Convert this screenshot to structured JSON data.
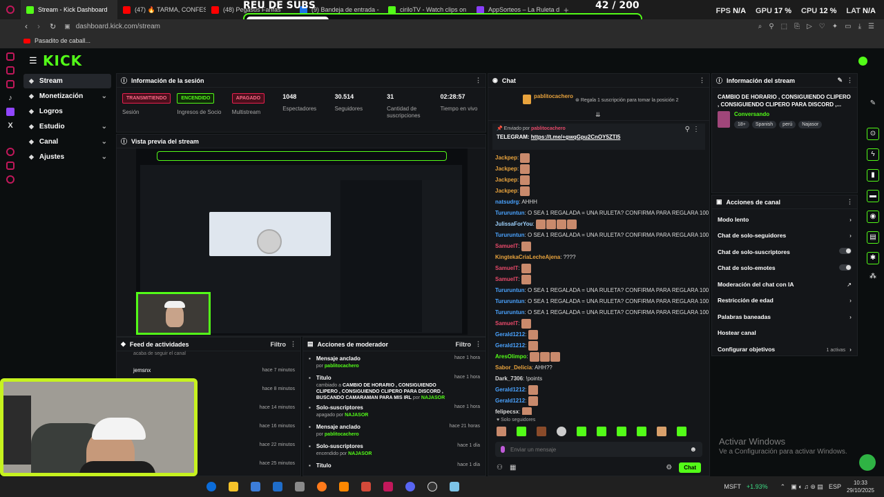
{
  "browser": {
    "tabs": [
      {
        "label": "Stream - Kick Dashboard",
        "color": "#53fc18",
        "active": true
      },
      {
        "label": "(47) 🔥 TARMA, CONFESI",
        "color": "#ff0000",
        "active": false
      },
      {
        "label": "(48) Pegasus Fanfas",
        "color": "#ff0000",
        "active": false
      },
      {
        "label": "(9) Bandeja de entrada -",
        "color": "#1a73e8",
        "active": false
      },
      {
        "label": "cirilоTV - Watch clips on",
        "color": "#53fc18",
        "active": false
      },
      {
        "label": "AppSorteos – La Ruleta de",
        "color": "#8a3ffc",
        "active": false
      }
    ],
    "url": "dashboard.kick.com/stream",
    "bookmark": "Pasadito de caball..."
  },
  "overlay": {
    "title": "REU DE SUBS",
    "count": "42 / 200",
    "progress": 0.21
  },
  "perf": {
    "fps_label": "FPS",
    "fps": "N/A",
    "gpu_label": "GPU",
    "gpu": "17 %",
    "cpu_label": "CPU",
    "cpu": "12 %",
    "lat_label": "LAT",
    "lat": "N/A"
  },
  "kick": {
    "logo": "KICK"
  },
  "nav": [
    {
      "label": "Stream",
      "active": true,
      "icon": "signal-icon"
    },
    {
      "label": "Monetización",
      "chevron": true,
      "icon": "dollar-icon"
    },
    {
      "label": "Logros",
      "icon": "trophy-icon"
    },
    {
      "label": "Estudio",
      "chevron": true,
      "icon": "studio-icon"
    },
    {
      "label": "Canal",
      "chevron": true,
      "icon": "flag-icon"
    },
    {
      "label": "Ajustes",
      "chevron": true,
      "icon": "gear-icon"
    }
  ],
  "session": {
    "title": "Información de la sesión",
    "items": [
      {
        "badge": "TRANSMITIENDO",
        "badge_color": "#e91e4e",
        "label": "Sesión"
      },
      {
        "badge": "ENCENDIDO",
        "badge_color": "#53fc18",
        "label": "Ingresos de Socio"
      },
      {
        "badge": "APAGADO",
        "badge_color": "#e91e4e",
        "label": "Multistream"
      },
      {
        "value": "1048",
        "label": "Espectadores"
      },
      {
        "value": "30.514",
        "label": "Seguidores"
      },
      {
        "value": "31",
        "label": "Cantidad de suscripciones"
      },
      {
        "value": "02:28:57",
        "label": "Tiempo en vivo"
      }
    ]
  },
  "preview": {
    "title": "Vista previa del stream"
  },
  "feed": {
    "title": "Feed de actividades",
    "filter": "Filtro",
    "rows": [
      {
        "user": "acaba de seguir el canal",
        "time": ""
      },
      {
        "user": "jemsnx",
        "time": "hace 7 minutos"
      },
      {
        "user": "",
        "time": "hace 8 minutos"
      },
      {
        "user": "",
        "time": "hace 14 minutos"
      },
      {
        "user": "",
        "time": "hace 16 minutos"
      },
      {
        "user": "",
        "time": "hace 22 minutos"
      },
      {
        "user": "",
        "time": "hace 25 minutos"
      }
    ]
  },
  "mod": {
    "title": "Acciones de moderador",
    "filter": "Filtro",
    "rows": [
      {
        "title": "Mensaje anclado",
        "sub_pre": "por ",
        "sub_user": "pablitocachero",
        "time": "hace 1 hora"
      },
      {
        "title": "Título",
        "sub_pre": "cambiado a ",
        "sub_bold": "CAMBIO DE HORARIO , CONSIGUIENDO CLIPERO , CONSIGUIENDO CLIPERO PARA DISCORD , BUSCANDO CAMARAMAN PARA MIS IRL",
        "sub_mid": " por ",
        "sub_user": "NAJASOR",
        "time": "hace 1 hora"
      },
      {
        "title": "Solo-suscriptores",
        "sub_pre": "apagado por ",
        "sub_user": "NAJASOR",
        "time": "hace 1 hora"
      },
      {
        "title": "Mensaje anclado",
        "sub_pre": "por ",
        "sub_user": "pablitocachero",
        "time": "hace 21 horas"
      },
      {
        "title": "Solo-suscriptores",
        "sub_pre": "encendido por ",
        "sub_user": "NAJASOR",
        "time": "hace 1 día"
      },
      {
        "title": "Título",
        "sub_pre": "",
        "sub_user": "",
        "time": "hace 1 día"
      }
    ]
  },
  "chat": {
    "title": "Chat",
    "gifter": "pablitocachero",
    "gift_text": "Regala 1 suscripción para tomar la posición 2",
    "pinned_by_label": "Enviado por",
    "pinned_user": "pablitocachero",
    "pinned_prefix": "TELEGRAM:",
    "pinned_link": "https://t.me/+gwqGpu2CnOY5ZTI5",
    "messages": [
      {
        "user": "Jackpep",
        "color": "#e8a33d",
        "text": "",
        "emotes": 1
      },
      {
        "user": "Jackpep",
        "color": "#e8a33d",
        "text": "",
        "emotes": 1
      },
      {
        "user": "Jackpep",
        "color": "#e8a33d",
        "text": "",
        "emotes": 1
      },
      {
        "user": "Jackpep",
        "color": "#e8a33d",
        "text": "",
        "emotes": 1
      },
      {
        "user": "natsudrg",
        "color": "#4aa3ff",
        "text": "AHHH",
        "emotes": 0
      },
      {
        "user": "Tururuntun",
        "color": "#4aa3ff",
        "text": "O SEA 1 REGALADA = UNA RULETA? CONFIRMA PARA REGLARA 100 SUBS",
        "emotes": 0
      },
      {
        "user": "JulissaForYou",
        "color": "#9fd3ff",
        "text": "",
        "emotes": 4
      },
      {
        "user": "Tururuntun",
        "color": "#4aa3ff",
        "text": "O SEA 1 REGALADA = UNA RULETA? CONFIRMA PARA REGLARA 100 SUBS",
        "emotes": 0
      },
      {
        "user": "SamuelT",
        "color": "#e84a6a",
        "text": "",
        "emotes": 1
      },
      {
        "user": "KingtekaCriaLecheAjena",
        "color": "#e8a33d",
        "text": "????",
        "emotes": 0
      },
      {
        "user": "SamuelT",
        "color": "#e84a6a",
        "text": "",
        "emotes": 1
      },
      {
        "user": "SamuelT",
        "color": "#e84a6a",
        "text": "",
        "emotes": 1
      },
      {
        "user": "Tururuntun",
        "color": "#4aa3ff",
        "text": "O SEA 1 REGALADA = UNA RULETA? CONFIRMA PARA REGLARA 100 SUBS",
        "emotes": 0
      },
      {
        "user": "Tururuntun",
        "color": "#4aa3ff",
        "text": "O SEA 1 REGALADA = UNA RULETA? CONFIRMA PARA REGLARA 100 SUBS",
        "emotes": 0
      },
      {
        "user": "Tururuntun",
        "color": "#4aa3ff",
        "text": "O SEA 1 REGALADA = UNA RULETA? CONFIRMA PARA REGLARA 100 SUBS",
        "emotes": 0
      },
      {
        "user": "SamuelT",
        "color": "#e84a6a",
        "text": "",
        "emotes": 1
      },
      {
        "user": "Gerald1212",
        "color": "#4aa3ff",
        "text": "",
        "emotes": 1
      },
      {
        "user": "Gerald1212",
        "color": "#4aa3ff",
        "text": "",
        "emotes": 1
      },
      {
        "user": "AresOlimpo",
        "color": "#53fc18",
        "text": "",
        "emotes": 3
      },
      {
        "user": "Sabor_Delicia",
        "color": "#e8a33d",
        "text": "AHH??",
        "emotes": 0
      },
      {
        "user": "Dark_7306",
        "color": "#dddddd",
        "text": "!points",
        "emotes": 0
      },
      {
        "user": "Gerald1212",
        "color": "#4aa3ff",
        "text": "",
        "emotes": 1
      },
      {
        "user": "Gerald1212",
        "color": "#4aa3ff",
        "text": "",
        "emotes": 1
      },
      {
        "user": "felipecsx",
        "color": "#dddddd",
        "text": "",
        "emotes": 1
      }
    ],
    "followers_only": "Solo seguidores",
    "input_placeholder": "Enviar un mensaje",
    "send": "Chat"
  },
  "stream_info": {
    "title": "Información del stream",
    "stream_title": "CAMBIO DE HORARIO , CONSIGUIENDO CLIPERO , CONSIGUIENDO CLIPERO PARA DISCORD ,...",
    "category": "Conversando",
    "tags": [
      "18+",
      "Spanish",
      "perú",
      "Najasor"
    ]
  },
  "channel_actions": {
    "title": "Acciones de canal",
    "items": [
      {
        "label": "Modo lento",
        "control": "chevron"
      },
      {
        "label": "Chat de solo-seguidores",
        "control": "chevron"
      },
      {
        "label": "Chat de solo-suscriptores",
        "control": "toggle"
      },
      {
        "label": "Chat de solo-emotes",
        "control": "toggle"
      },
      {
        "label": "Moderación del chat con IA",
        "control": "link"
      },
      {
        "label": "Restricción de edad",
        "control": "chevron"
      },
      {
        "label": "Palabras baneadas",
        "control": "chevron"
      },
      {
        "label": "Hostear canal",
        "control": "none"
      },
      {
        "label": "Configurar objetivos",
        "control": "chevron",
        "extra": "1 activas"
      }
    ]
  },
  "windows": {
    "line1": "Activar Windows",
    "line2": "Ve a Configuración para activar Windows."
  },
  "taskbar": {
    "ticker": "MSFT",
    "change": "+1.93%",
    "lang": "ESP",
    "time": "10:33",
    "date": "29/10/2025"
  }
}
